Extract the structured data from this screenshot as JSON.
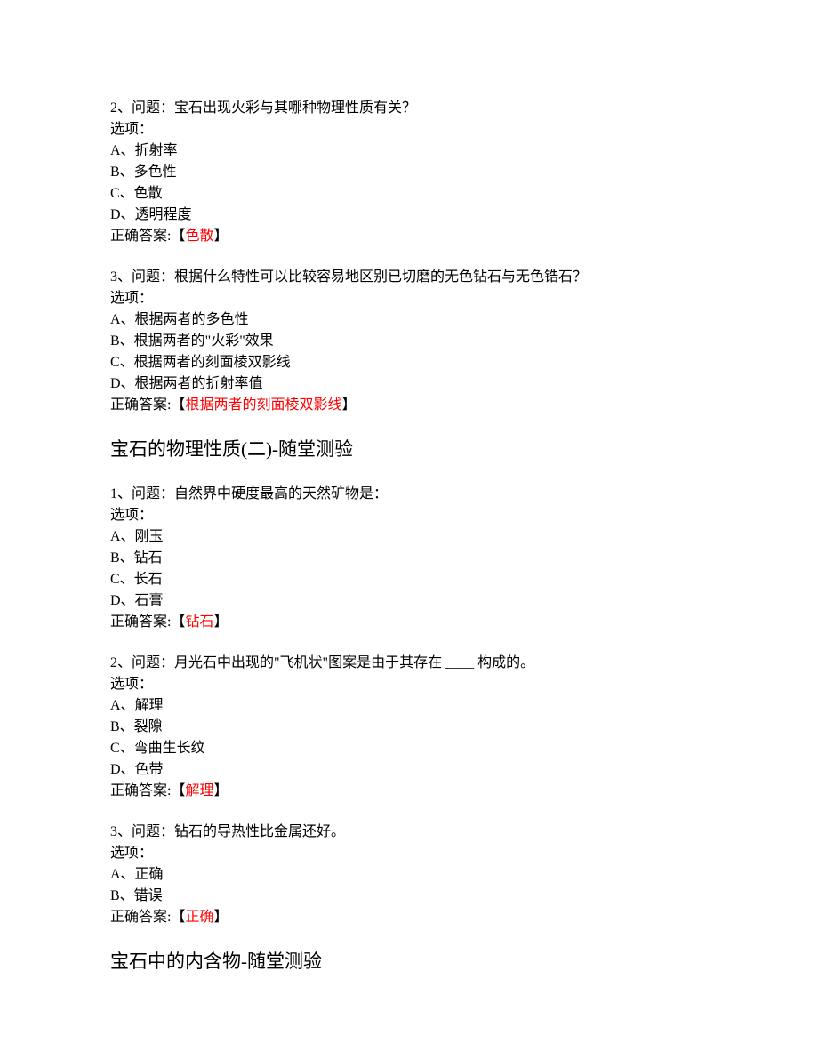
{
  "questions": [
    {
      "number": "2、问题：宝石出现火彩与其哪种物理性质有关？",
      "optionsLabel": "选项：",
      "options": [
        "A、折射率",
        "B、多色性",
        "C、色散",
        "D、透明程度"
      ],
      "answerPrefix": "正确答案:【",
      "answerText": "色散",
      "answerSuffix": "】"
    },
    {
      "number": "3、问题：根据什么特性可以比较容易地区别已切磨的无色钻石与无色锆石？",
      "optionsLabel": "选项：",
      "options": [
        "A、根据两者的多色性",
        "B、根据两者的\"火彩\"效果",
        "C、根据两者的刻面棱双影线",
        "D、根据两者的折射率值"
      ],
      "answerPrefix": "正确答案:【",
      "answerText": "根据两者的刻面棱双影线",
      "answerSuffix": "】"
    }
  ],
  "sectionTitle1": "宝石的物理性质(二)-随堂测验",
  "questions2": [
    {
      "number": "1、问题：自然界中硬度最高的天然矿物是：",
      "optionsLabel": "选项：",
      "options": [
        "A、刚玉",
        "B、钻石",
        "C、长石",
        "D、石膏"
      ],
      "answerPrefix": "正确答案:【",
      "answerText": "钻石",
      "answerSuffix": "】"
    },
    {
      "number": "2、问题：月光石中出现的\"飞机状\"图案是由于其存在 ____ 构成的。",
      "optionsLabel": "选项：",
      "options": [
        "A、解理",
        "B、裂隙",
        "C、弯曲生长纹",
        "D、色带"
      ],
      "answerPrefix": "正确答案:【",
      "answerText": "解理",
      "answerSuffix": "】"
    },
    {
      "number": "3、问题：钻石的导热性比金属还好。",
      "optionsLabel": "选项：",
      "options": [
        "A、正确",
        "B、错误"
      ],
      "answerPrefix": "正确答案:【",
      "answerText": "正确",
      "answerSuffix": "】"
    }
  ],
  "sectionTitle2": "宝石中的内含物-随堂测验"
}
